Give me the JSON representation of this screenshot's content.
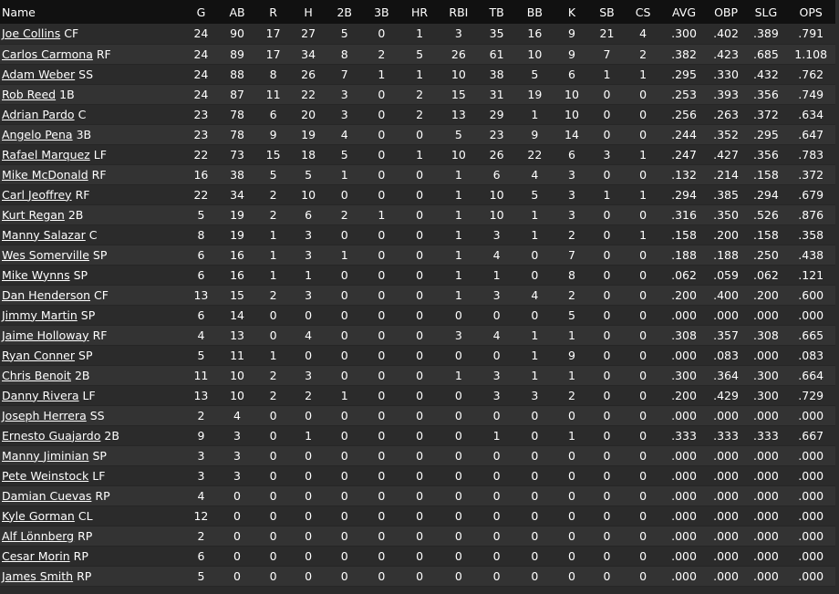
{
  "columns": [
    "Name",
    "G",
    "AB",
    "R",
    "H",
    "2B",
    "3B",
    "HR",
    "RBI",
    "TB",
    "BB",
    "K",
    "SB",
    "CS",
    "AVG",
    "OBP",
    "SLG",
    "OPS"
  ],
  "rows": [
    {
      "name": "Joe Collins",
      "pos": "CF",
      "stats": [
        "24",
        "90",
        "17",
        "27",
        "5",
        "0",
        "1",
        "3",
        "35",
        "16",
        "9",
        "21",
        "4",
        ".300",
        ".402",
        ".389",
        ".791"
      ]
    },
    {
      "name": "Carlos Carmona",
      "pos": "RF",
      "stats": [
        "24",
        "89",
        "17",
        "34",
        "8",
        "2",
        "5",
        "26",
        "61",
        "10",
        "9",
        "7",
        "2",
        ".382",
        ".423",
        ".685",
        "1.108"
      ]
    },
    {
      "name": "Adam Weber",
      "pos": "SS",
      "stats": [
        "24",
        "88",
        "8",
        "26",
        "7",
        "1",
        "1",
        "10",
        "38",
        "5",
        "6",
        "1",
        "1",
        ".295",
        ".330",
        ".432",
        ".762"
      ]
    },
    {
      "name": "Rob Reed",
      "pos": "1B",
      "stats": [
        "24",
        "87",
        "11",
        "22",
        "3",
        "0",
        "2",
        "15",
        "31",
        "19",
        "10",
        "0",
        "0",
        ".253",
        ".393",
        ".356",
        ".749"
      ]
    },
    {
      "name": "Adrian Pardo",
      "pos": "C",
      "stats": [
        "23",
        "78",
        "6",
        "20",
        "3",
        "0",
        "2",
        "13",
        "29",
        "1",
        "10",
        "0",
        "0",
        ".256",
        ".263",
        ".372",
        ".634"
      ]
    },
    {
      "name": "Angelo Pena",
      "pos": "3B",
      "stats": [
        "23",
        "78",
        "9",
        "19",
        "4",
        "0",
        "0",
        "5",
        "23",
        "9",
        "14",
        "0",
        "0",
        ".244",
        ".352",
        ".295",
        ".647"
      ]
    },
    {
      "name": "Rafael Marquez",
      "pos": "LF",
      "stats": [
        "22",
        "73",
        "15",
        "18",
        "5",
        "0",
        "1",
        "10",
        "26",
        "22",
        "6",
        "3",
        "1",
        ".247",
        ".427",
        ".356",
        ".783"
      ]
    },
    {
      "name": "Mike McDonald",
      "pos": "RF",
      "stats": [
        "16",
        "38",
        "5",
        "5",
        "1",
        "0",
        "0",
        "1",
        "6",
        "4",
        "3",
        "0",
        "0",
        ".132",
        ".214",
        ".158",
        ".372"
      ]
    },
    {
      "name": "Carl Jeoffrey",
      "pos": "RF",
      "stats": [
        "22",
        "34",
        "2",
        "10",
        "0",
        "0",
        "0",
        "1",
        "10",
        "5",
        "3",
        "1",
        "1",
        ".294",
        ".385",
        ".294",
        ".679"
      ]
    },
    {
      "name": "Kurt Regan",
      "pos": "2B",
      "stats": [
        "5",
        "19",
        "2",
        "6",
        "2",
        "1",
        "0",
        "1",
        "10",
        "1",
        "3",
        "0",
        "0",
        ".316",
        ".350",
        ".526",
        ".876"
      ]
    },
    {
      "name": "Manny Salazar",
      "pos": "C",
      "stats": [
        "8",
        "19",
        "1",
        "3",
        "0",
        "0",
        "0",
        "1",
        "3",
        "1",
        "2",
        "0",
        "1",
        ".158",
        ".200",
        ".158",
        ".358"
      ]
    },
    {
      "name": "Wes Somerville",
      "pos": "SP",
      "stats": [
        "6",
        "16",
        "1",
        "3",
        "1",
        "0",
        "0",
        "1",
        "4",
        "0",
        "7",
        "0",
        "0",
        ".188",
        ".188",
        ".250",
        ".438"
      ]
    },
    {
      "name": "Mike Wynns",
      "pos": "SP",
      "stats": [
        "6",
        "16",
        "1",
        "1",
        "0",
        "0",
        "0",
        "1",
        "1",
        "0",
        "8",
        "0",
        "0",
        ".062",
        ".059",
        ".062",
        ".121"
      ]
    },
    {
      "name": "Dan Henderson",
      "pos": "CF",
      "stats": [
        "13",
        "15",
        "2",
        "3",
        "0",
        "0",
        "0",
        "1",
        "3",
        "4",
        "2",
        "0",
        "0",
        ".200",
        ".400",
        ".200",
        ".600"
      ]
    },
    {
      "name": "Jimmy Martin",
      "pos": "SP",
      "stats": [
        "6",
        "14",
        "0",
        "0",
        "0",
        "0",
        "0",
        "0",
        "0",
        "0",
        "5",
        "0",
        "0",
        ".000",
        ".000",
        ".000",
        ".000"
      ]
    },
    {
      "name": "Jaime Holloway",
      "pos": "RF",
      "stats": [
        "4",
        "13",
        "0",
        "4",
        "0",
        "0",
        "0",
        "3",
        "4",
        "1",
        "1",
        "0",
        "0",
        ".308",
        ".357",
        ".308",
        ".665"
      ]
    },
    {
      "name": "Ryan Conner",
      "pos": "SP",
      "stats": [
        "5",
        "11",
        "1",
        "0",
        "0",
        "0",
        "0",
        "0",
        "0",
        "1",
        "9",
        "0",
        "0",
        ".000",
        ".083",
        ".000",
        ".083"
      ]
    },
    {
      "name": "Chris Benoit",
      "pos": "2B",
      "stats": [
        "11",
        "10",
        "2",
        "3",
        "0",
        "0",
        "0",
        "1",
        "3",
        "1",
        "1",
        "0",
        "0",
        ".300",
        ".364",
        ".300",
        ".664"
      ]
    },
    {
      "name": "Danny Rivera",
      "pos": "LF",
      "stats": [
        "13",
        "10",
        "2",
        "2",
        "1",
        "0",
        "0",
        "0",
        "3",
        "3",
        "2",
        "0",
        "0",
        ".200",
        ".429",
        ".300",
        ".729"
      ]
    },
    {
      "name": "Joseph Herrera",
      "pos": "SS",
      "stats": [
        "2",
        "4",
        "0",
        "0",
        "0",
        "0",
        "0",
        "0",
        "0",
        "0",
        "0",
        "0",
        "0",
        ".000",
        ".000",
        ".000",
        ".000"
      ]
    },
    {
      "name": "Ernesto Guajardo",
      "pos": "2B",
      "stats": [
        "9",
        "3",
        "0",
        "1",
        "0",
        "0",
        "0",
        "0",
        "1",
        "0",
        "1",
        "0",
        "0",
        ".333",
        ".333",
        ".333",
        ".667"
      ]
    },
    {
      "name": "Manny Jiminian",
      "pos": "SP",
      "stats": [
        "3",
        "3",
        "0",
        "0",
        "0",
        "0",
        "0",
        "0",
        "0",
        "0",
        "0",
        "0",
        "0",
        ".000",
        ".000",
        ".000",
        ".000"
      ]
    },
    {
      "name": "Pete Weinstock",
      "pos": "LF",
      "stats": [
        "3",
        "3",
        "0",
        "0",
        "0",
        "0",
        "0",
        "0",
        "0",
        "0",
        "0",
        "0",
        "0",
        ".000",
        ".000",
        ".000",
        ".000"
      ]
    },
    {
      "name": "Damian Cuevas",
      "pos": "RP",
      "stats": [
        "4",
        "0",
        "0",
        "0",
        "0",
        "0",
        "0",
        "0",
        "0",
        "0",
        "0",
        "0",
        "0",
        ".000",
        ".000",
        ".000",
        ".000"
      ]
    },
    {
      "name": "Kyle Gorman",
      "pos": "CL",
      "stats": [
        "12",
        "0",
        "0",
        "0",
        "0",
        "0",
        "0",
        "0",
        "0",
        "0",
        "0",
        "0",
        "0",
        ".000",
        ".000",
        ".000",
        ".000"
      ]
    },
    {
      "name": "Alf Lönnberg",
      "pos": "RP",
      "stats": [
        "2",
        "0",
        "0",
        "0",
        "0",
        "0",
        "0",
        "0",
        "0",
        "0",
        "0",
        "0",
        "0",
        ".000",
        ".000",
        ".000",
        ".000"
      ]
    },
    {
      "name": "Cesar Morin",
      "pos": "RP",
      "stats": [
        "6",
        "0",
        "0",
        "0",
        "0",
        "0",
        "0",
        "0",
        "0",
        "0",
        "0",
        "0",
        "0",
        ".000",
        ".000",
        ".000",
        ".000"
      ]
    },
    {
      "name": "James Smith",
      "pos": "RP",
      "stats": [
        "5",
        "0",
        "0",
        "0",
        "0",
        "0",
        "0",
        "0",
        "0",
        "0",
        "0",
        "0",
        "0",
        ".000",
        ".000",
        ".000",
        ".000"
      ]
    }
  ]
}
